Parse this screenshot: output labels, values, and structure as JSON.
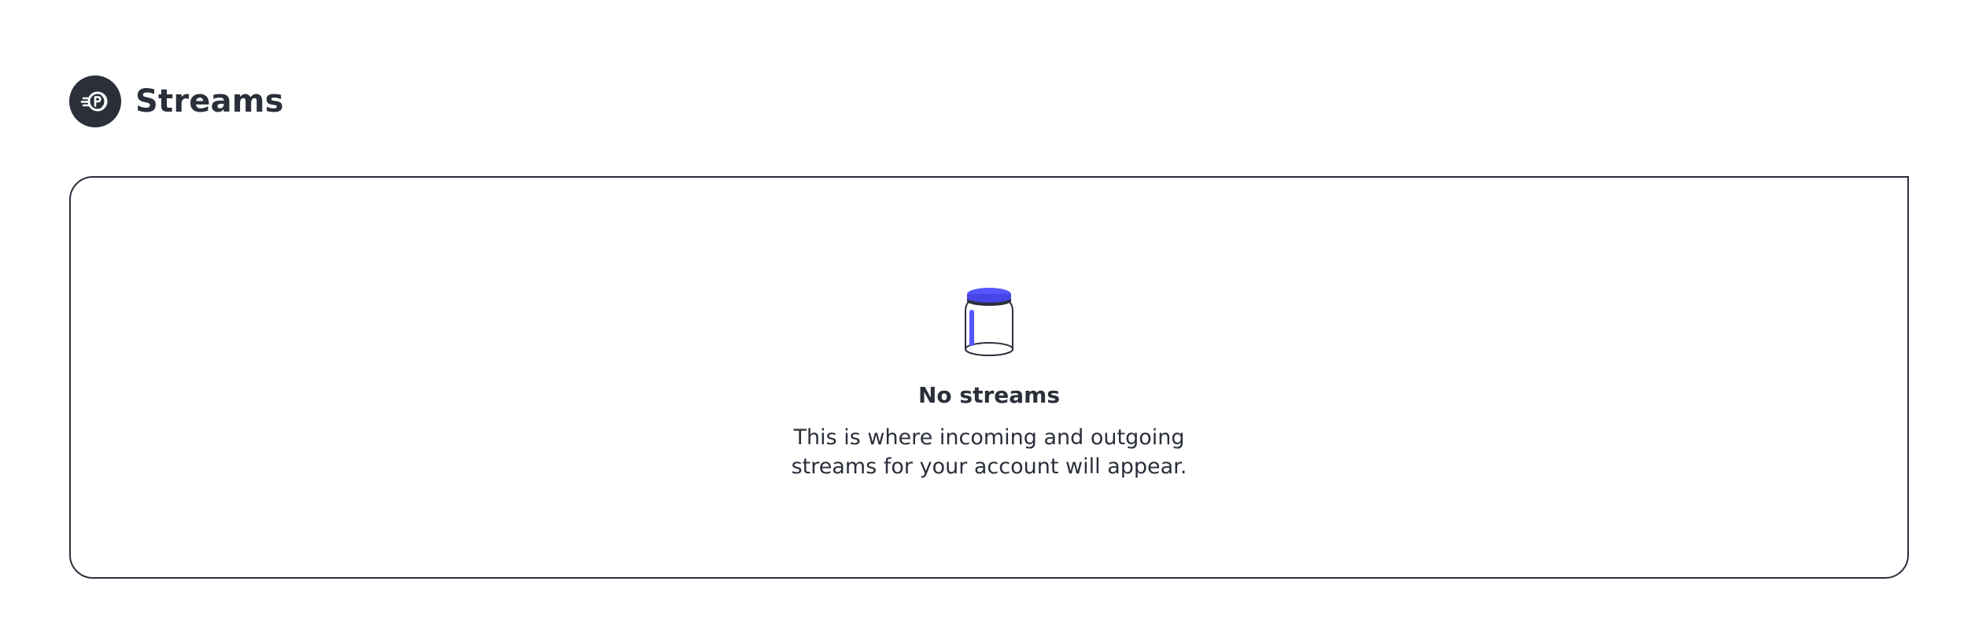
{
  "header": {
    "title": "Streams",
    "icon": "streams-coin-icon"
  },
  "empty_state": {
    "illustration": "empty-jar-icon",
    "title": "No streams",
    "description": "This is where incoming and outgoing streams for your account will appear."
  },
  "colors": {
    "text": "#2a2f3a",
    "accent": "#5555ff",
    "background": "#ffffff"
  }
}
